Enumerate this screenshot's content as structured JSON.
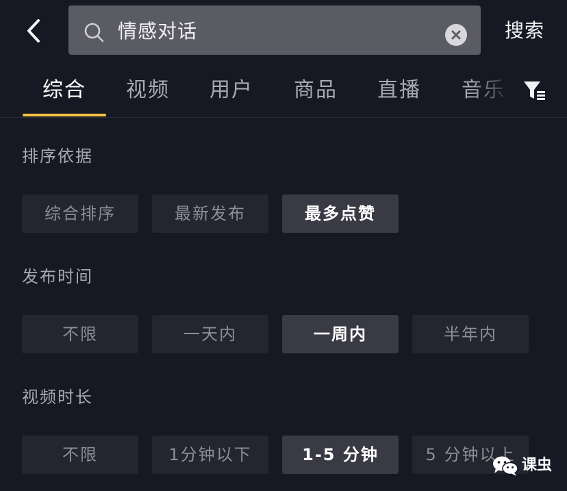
{
  "header": {
    "back_icon": "chevron-left-icon",
    "search": {
      "value": "情感对话",
      "placeholder": "",
      "icon": "search-icon",
      "clear_icon": "close-circle-icon"
    },
    "search_button_label": "搜索"
  },
  "tabs": {
    "items": [
      {
        "label": "综合"
      },
      {
        "label": "视频"
      },
      {
        "label": "用户"
      },
      {
        "label": "商品"
      },
      {
        "label": "直播"
      },
      {
        "label": "音乐"
      }
    ],
    "active_index": 0,
    "filter_icon": "filter-icon",
    "accent_color": "#f5c443"
  },
  "filters": {
    "sort": {
      "title": "排序依据",
      "options": [
        "综合排序",
        "最新发布",
        "最多点赞"
      ],
      "selected_index": 2
    },
    "publish_time": {
      "title": "发布时间",
      "options": [
        "不限",
        "一天内",
        "一周内",
        "半年内"
      ],
      "selected_index": 2
    },
    "duration": {
      "title": "视频时长",
      "options": [
        "不限",
        "1分钟以下",
        "1-5 分钟",
        "5 分钟以上"
      ],
      "selected_index": 2
    }
  },
  "watermark": {
    "text": "课虫",
    "logo_icon": "wechat-logo-icon"
  },
  "colors": {
    "background": "#161823",
    "option_bg": "#23252f",
    "option_selected_bg": "#393a44",
    "search_bg": "#5a5b63",
    "accent": "#f5c443"
  }
}
